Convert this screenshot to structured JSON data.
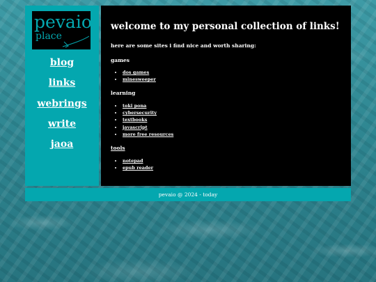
{
  "logo": {
    "line1": "pevaio",
    "line2": "place"
  },
  "nav": [
    {
      "label": "blog"
    },
    {
      "label": "links"
    },
    {
      "label": "webrings"
    },
    {
      "label": "write"
    },
    {
      "label": "jaoa"
    }
  ],
  "main": {
    "heading": "welcome to my personal collection of links!",
    "intro": "here are some sites i find nice and worth sharing:",
    "sections": [
      {
        "title": "games",
        "items": [
          "dos games",
          "minesweeper"
        ]
      },
      {
        "title": "learning",
        "items": [
          "toki pona",
          "cybersecurity",
          "textbooks",
          "javascript",
          "more free resources"
        ]
      },
      {
        "title": "tools",
        "items": [
          "notepad",
          "epub reader"
        ]
      }
    ]
  },
  "footer": {
    "text": "pevaio @ 2024 - today"
  },
  "colors": {
    "accent": "#04a7af",
    "panel": "#000000",
    "text": "#ffffff"
  }
}
